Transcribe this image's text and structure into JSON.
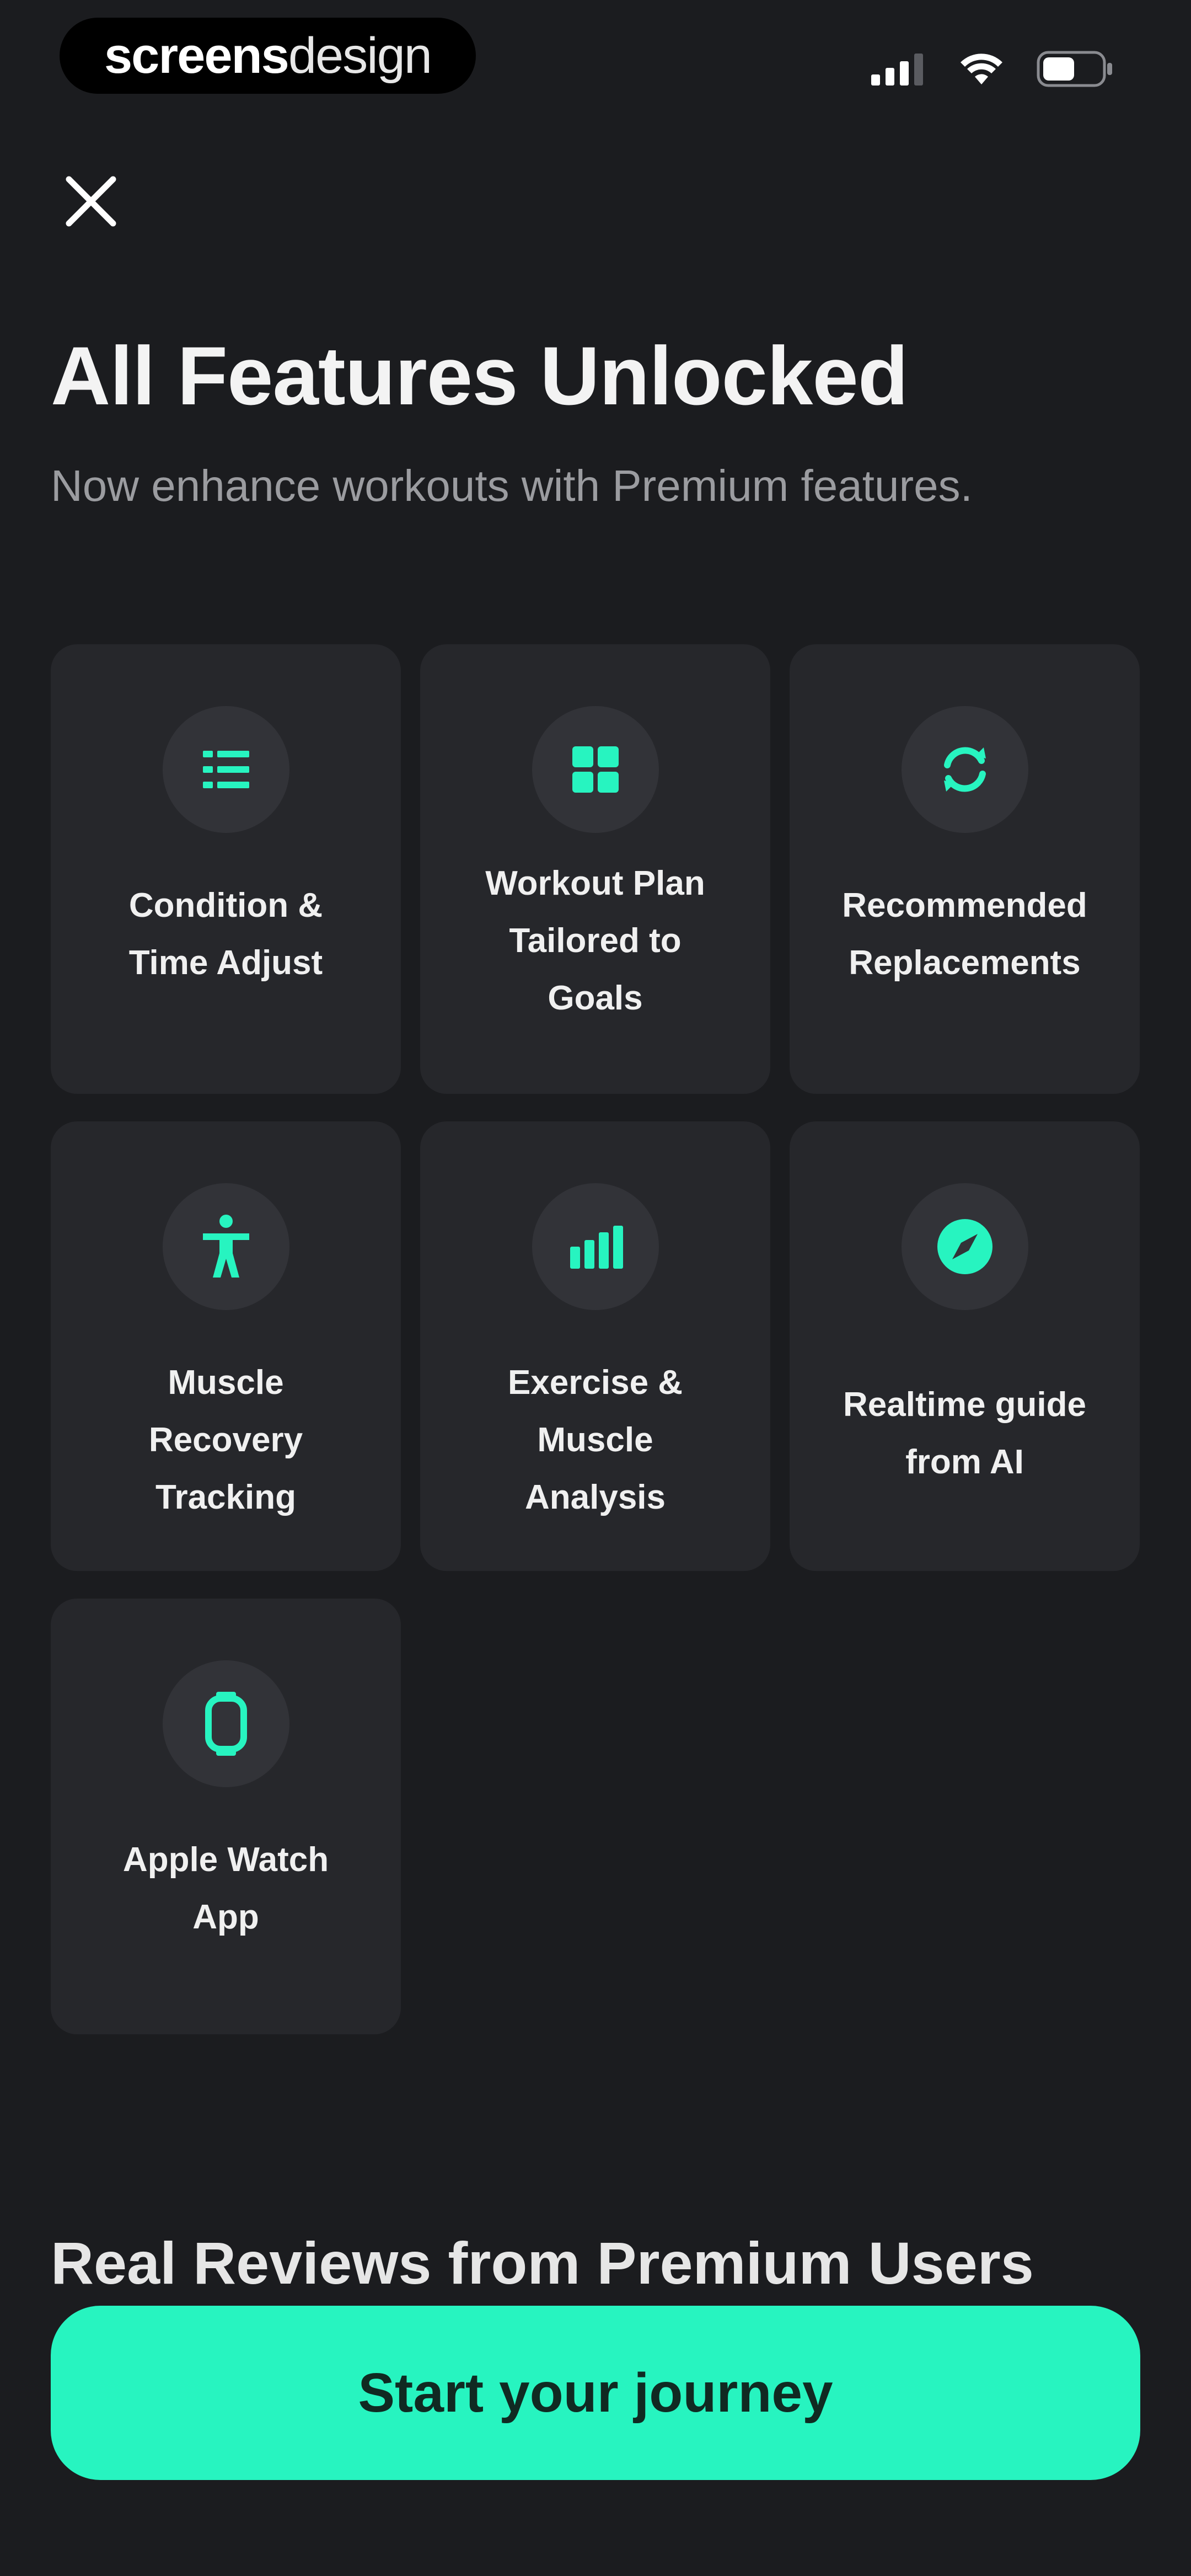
{
  "status_bar": {
    "brand_strong": "screens",
    "brand_light": "design"
  },
  "header": {
    "title": "All Features Unlocked",
    "subtitle": "Now enhance workouts with Premium features."
  },
  "features": [
    {
      "label": "Condition &\nTime Adjust",
      "icon": "list-icon"
    },
    {
      "label": "Workout Plan\nTailored to\nGoals",
      "icon": "grid-icon"
    },
    {
      "label": "Recommended\nReplacements",
      "icon": "refresh-icon"
    },
    {
      "label": "Muscle\nRecovery\nTracking",
      "icon": "person-icon"
    },
    {
      "label": "Exercise &\nMuscle\nAnalysis",
      "icon": "bar-chart-icon"
    },
    {
      "label": "Realtime guide\nfrom AI",
      "icon": "compass-icon"
    },
    {
      "label": "Apple Watch\nApp",
      "icon": "watch-icon"
    }
  ],
  "reviews": {
    "heading": "Real Reviews from Premium Users"
  },
  "cta": {
    "label": "Start your journey"
  },
  "colors": {
    "background": "#1b1c1f",
    "card": "#26272b",
    "accent": "#27f4c0"
  }
}
